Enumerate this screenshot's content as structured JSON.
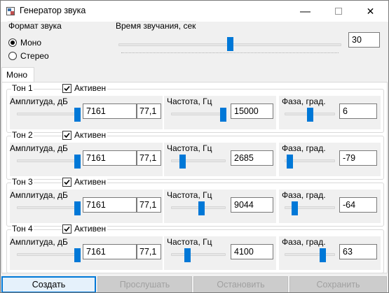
{
  "window": {
    "title": "Генератор звука",
    "minimize": "—",
    "close": "✕"
  },
  "format": {
    "label": "Формат звука",
    "options": [
      "Моно",
      "Стерео"
    ],
    "selected": "Моно"
  },
  "duration": {
    "label": "Время звучания, сек",
    "value": "30",
    "slider_fraction": 0.5
  },
  "tabs": [
    {
      "label": "Моно"
    }
  ],
  "labels": {
    "amp": "Амплитуда, дБ",
    "freq": "Частота, Гц",
    "phase": "Фаза, град.",
    "active": "Активен"
  },
  "tones": [
    {
      "label": "Тон 1",
      "active": true,
      "amp_value": "7161",
      "amp_db": "77,1",
      "amp_fraction": 0.95,
      "freq_value": "15000",
      "freq_fraction": 0.95,
      "phase_value": "6",
      "phase_fraction": 0.5
    },
    {
      "label": "Тон 2",
      "active": true,
      "amp_value": "7161",
      "amp_db": "77,1",
      "amp_fraction": 0.95,
      "freq_value": "2685",
      "freq_fraction": 0.2,
      "phase_value": "-79",
      "phase_fraction": 0.1
    },
    {
      "label": "Тон 3",
      "active": true,
      "amp_value": "7161",
      "amp_db": "77,1",
      "amp_fraction": 0.95,
      "freq_value": "9044",
      "freq_fraction": 0.55,
      "phase_value": "-64",
      "phase_fraction": 0.2
    },
    {
      "label": "Тон 4",
      "active": true,
      "amp_value": "7161",
      "amp_db": "77,1",
      "amp_fraction": 0.95,
      "freq_value": "4100",
      "freq_fraction": 0.3,
      "phase_value": "63",
      "phase_fraction": 0.75
    }
  ],
  "buttons": {
    "create": "Создать",
    "listen": "Прослушать",
    "stop": "Остановить",
    "save": "Сохранить"
  },
  "colors": {
    "accent": "#0078d7",
    "disabled_text": "#a0a0a0"
  }
}
